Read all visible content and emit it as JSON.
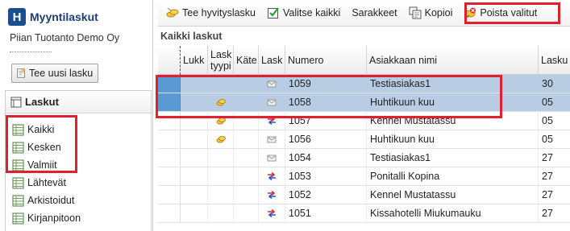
{
  "app": {
    "logo_letter": "H",
    "title": "Myyntilaskut",
    "company": "Piian Tuotanto Demo Oy"
  },
  "sidebar": {
    "new_invoice_label": "Tee uusi lasku",
    "panel_title": "Laskut",
    "items": [
      {
        "label": "Kaikki"
      },
      {
        "label": "Kesken"
      },
      {
        "label": "Valmiit"
      },
      {
        "label": "Lähtevät"
      },
      {
        "label": "Arkistoidut"
      },
      {
        "label": "Kirjanpitoon"
      }
    ]
  },
  "toolbar": {
    "credit_note_label": "Tee hyvityslasku",
    "select_all_label": "Valitse kaikki",
    "columns_label": "Sarakkeet",
    "copy_label": "Kopioi",
    "delete_selected_label": "Poista valitut"
  },
  "section_title": "Kaikki laskut",
  "grid": {
    "columns": [
      {
        "label": "Lukk"
      },
      {
        "label": "Lask tyypi"
      },
      {
        "label": "Käte"
      },
      {
        "label": "Lask"
      },
      {
        "label": "Numero"
      },
      {
        "label": "Asiakkaan nimi"
      },
      {
        "label": "Lasku"
      }
    ],
    "rows": [
      {
        "selected": true,
        "type_icon": "coins-icon",
        "has_type": false,
        "status_icon": "envelope-icon",
        "number": "1059",
        "customer": "Testiasiakas1",
        "date": "30"
      },
      {
        "selected": true,
        "type_icon": "coins-icon",
        "has_type": true,
        "status_icon": "envelope-icon",
        "number": "1058",
        "customer": "Huhtikuun kuu",
        "date": "05"
      },
      {
        "selected": false,
        "type_icon": "coins-icon",
        "has_type": true,
        "status_icon": "transfer-arrows-icon",
        "number": "1057",
        "customer": "Kennel Mustatassu",
        "date": "05"
      },
      {
        "selected": false,
        "type_icon": "coins-icon",
        "has_type": true,
        "status_icon": "envelope-icon",
        "number": "1056",
        "customer": "Huhtikuun kuu",
        "date": "05"
      },
      {
        "selected": false,
        "type_icon": "coins-icon",
        "has_type": false,
        "status_icon": "envelope-icon",
        "number": "1054",
        "customer": "Testiasiakas1",
        "date": "27"
      },
      {
        "selected": false,
        "type_icon": "coins-icon",
        "has_type": false,
        "status_icon": "transfer-arrows-icon",
        "number": "1053",
        "customer": "Ponitalli Kopina",
        "date": "27"
      },
      {
        "selected": false,
        "type_icon": "coins-icon",
        "has_type": false,
        "status_icon": "transfer-arrows-icon",
        "number": "1052",
        "customer": "Kennel Mustatassu",
        "date": "27"
      },
      {
        "selected": false,
        "type_icon": "coins-icon",
        "has_type": false,
        "status_icon": "transfer-arrows-icon",
        "number": "1051",
        "customer": "Kissahotelli Miukumauku",
        "date": "27"
      }
    ]
  },
  "colors": {
    "selection": "#b8cce4",
    "selection_box": "#5b9bd5",
    "highlight": "#e0202e",
    "brand": "#1b4e8f"
  }
}
